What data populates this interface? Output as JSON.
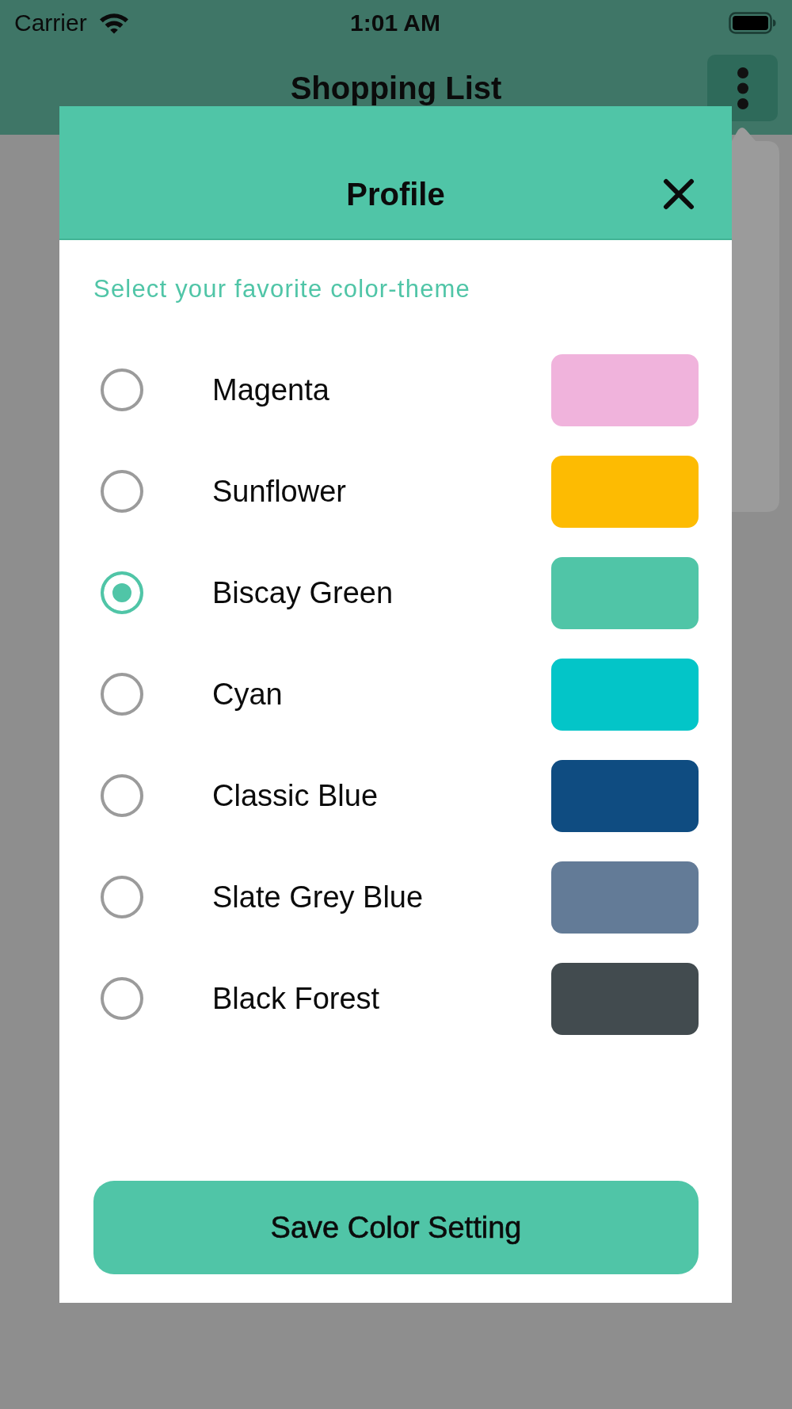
{
  "status_bar": {
    "carrier": "Carrier",
    "time": "1:01 AM"
  },
  "app_bar": {
    "title": "Shopping List"
  },
  "dialog": {
    "title": "Profile",
    "subtitle": "Select your favorite color-theme",
    "themes": [
      {
        "name": "Magenta",
        "color": "#f0b3dc",
        "selected": false
      },
      {
        "name": "Sunflower",
        "color": "#fdbb02",
        "selected": false
      },
      {
        "name": "Biscay Green",
        "color": "#50c5a7",
        "selected": true
      },
      {
        "name": "Cyan",
        "color": "#03c5c8",
        "selected": false
      },
      {
        "name": "Classic Blue",
        "color": "#0f4c81",
        "selected": false
      },
      {
        "name": "Slate Grey Blue",
        "color": "#637b97",
        "selected": false
      },
      {
        "name": "Black Forest",
        "color": "#424b4f",
        "selected": false
      }
    ],
    "save_button": "Save Color Setting"
  }
}
